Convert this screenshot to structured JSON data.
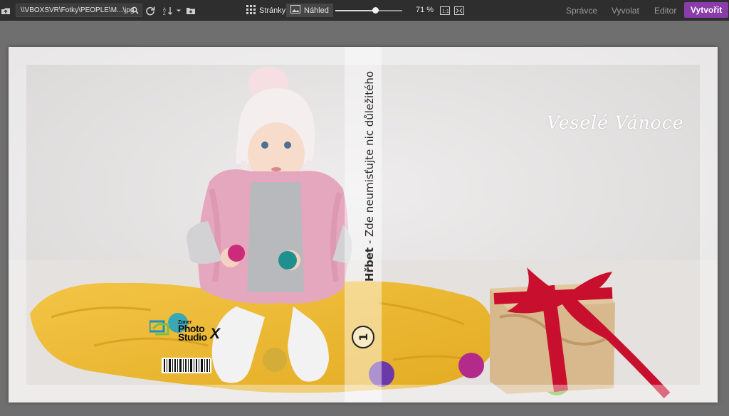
{
  "toolbar": {
    "path": "\\\\VBOXSVR\\Fotky\\PEOPLE\\M...\\jpg",
    "view_pages_label": "Stránky",
    "view_preview_label": "Náhled",
    "zoom": {
      "value_percent": 71,
      "label": "71 %",
      "slider_fraction": 0.6
    },
    "modes": [
      {
        "label": "Správce",
        "active": false
      },
      {
        "label": "Vyvolat",
        "active": false
      },
      {
        "label": "Editor",
        "active": false
      },
      {
        "label": "Vytvořit",
        "active": true
      }
    ],
    "icons": [
      "up-folder-icon",
      "search-icon",
      "refresh-icon",
      "sort-icon",
      "chevron-down-icon",
      "new-folder-icon",
      "pages-grid-icon",
      "image-preview-icon",
      "actual-size-icon",
      "fit-screen-icon"
    ]
  },
  "cover": {
    "greeting": "Veselé Vánoce",
    "spine_text_bold": "Hřbet",
    "spine_text": " - Zde neumisťujte nic důležitého",
    "spine_logo": "1",
    "logo": {
      "small": "Zoner",
      "line1": "Photo",
      "line2": "Studio",
      "x": "X"
    }
  },
  "colors": {
    "accent": "#8a3cab",
    "toolbar_bg": "#2e2e2e",
    "workspace_bg": "#6f6f6f"
  }
}
